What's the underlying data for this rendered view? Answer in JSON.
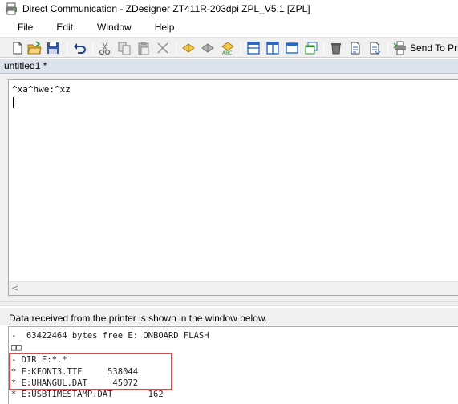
{
  "window": {
    "title": "Direct Communication - ZDesigner ZT411R-203dpi ZPL_V5.1 [ZPL]"
  },
  "menu": {
    "file": "File",
    "edit": "Edit",
    "window": "Window",
    "help": "Help"
  },
  "toolbar": {
    "icons": [
      "new-icon",
      "open-icon",
      "save-icon",
      "undo-icon",
      "cut-icon",
      "copy-icon",
      "paste-icon",
      "delete-icon",
      "format-icon",
      "auto-format-icon",
      "syntax-check-icon",
      "split-horizontal-icon",
      "split-vertical-icon",
      "window-icon",
      "tile-icon",
      "clear-icon",
      "open-file-icon",
      "save-file-icon",
      "send-icon"
    ],
    "send_label": "Send To Printer"
  },
  "document": {
    "tab_label": "untitled1 *",
    "command_text": "^xa^hwe:^xz"
  },
  "response": {
    "label": "Data received from the printer is shown in the window below.",
    "lines": [
      "-  63422464 bytes free E: ONBOARD FLASH",
      "□□",
      "- DIR E:*.*",
      "* E:KFONT3.TTF     538044",
      "* E:UHANGUL.DAT     45072",
      "* E:USBTIMESTAMP.DAT       162"
    ]
  },
  "colors": {
    "highlight": "#e0454c",
    "tab_bg": "#dde3ec"
  }
}
